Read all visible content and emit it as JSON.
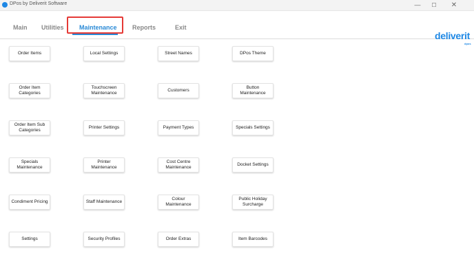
{
  "window": {
    "title": "DPos by Deliverit Software",
    "min_glyph": "—",
    "max_glyph": "☐",
    "close_glyph": "✕"
  },
  "tabs": {
    "main": "Main",
    "utilities": "Utilities",
    "maintenance": "Maintenance",
    "reports": "Reports",
    "exit": "Exit"
  },
  "brand": {
    "name": "deliverit",
    "sub": "dpos"
  },
  "colors": {
    "accent": "#2a8ad6",
    "highlight": "#e53935",
    "brand": "#1e88e5"
  },
  "tiles": {
    "r1": [
      "Order Items",
      "Local Settings",
      "Street Names",
      "DPos Theme"
    ],
    "r2": [
      "Order Item Categories",
      "Touchscreen Maintenance",
      "Customers",
      "Button Maintenance"
    ],
    "r3": [
      "Order Item Sub Categories",
      "Printer Settings",
      "Payment Types",
      "Specials Settings"
    ],
    "r4": [
      "Specials Maintenance",
      "Printer Maintenance",
      "Cost Centre Maintenance",
      "Docket Settings"
    ],
    "r5": [
      "Condiment Pricing",
      "Staff Maintenance",
      "Colour Maintenance",
      "Public Holiday Surcharge"
    ],
    "r6": [
      "Settings",
      "Security Profiles",
      "Order Extras",
      "Item Barcodes"
    ]
  }
}
